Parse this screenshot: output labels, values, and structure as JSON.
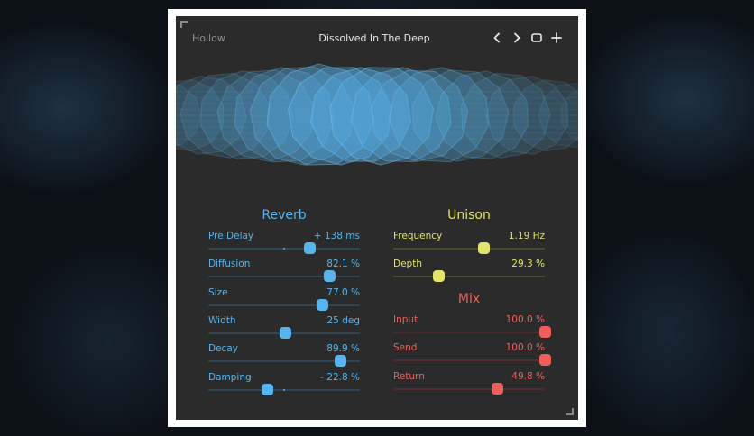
{
  "header": {
    "bank": "Hollow",
    "preset": "Dissolved In The Deep",
    "prev_icon": "chevron-left-icon",
    "next_icon": "chevron-right-icon",
    "window_icon": "window-icon",
    "add_icon": "plus-icon",
    "prev_glyph": "‹",
    "next_glyph": "›",
    "add_glyph": "+"
  },
  "colors": {
    "reverb": "#58b4ec",
    "reverb_track": "#2e4656",
    "unison": "#e3e46a",
    "unison_track": "#4a4a2c",
    "mix": "#ee5f5b",
    "mix_track": "#4e2d2d"
  },
  "reverb": {
    "title": "Reverb",
    "params": [
      {
        "name": "Pre Delay",
        "value": "+ 138 ms",
        "level": 0.67,
        "bipolar": true
      },
      {
        "name": "Diffusion",
        "value": "82.1 %",
        "level": 0.8,
        "bipolar": false
      },
      {
        "name": "Size",
        "value": "77.0 %",
        "level": 0.75,
        "bipolar": false
      },
      {
        "name": "Width",
        "value": "25 deg",
        "level": 0.51,
        "bipolar": false
      },
      {
        "name": "Decay",
        "value": "89.9 %",
        "level": 0.87,
        "bipolar": false
      },
      {
        "name": "Damping",
        "value": "- 22.8 %",
        "level": 0.39,
        "bipolar": true
      }
    ]
  },
  "unison": {
    "title": "Unison",
    "params": [
      {
        "name": "Frequency",
        "value": "1.19 Hz",
        "level": 0.6
      },
      {
        "name": "Depth",
        "value": "29.3 %",
        "level": 0.3
      }
    ]
  },
  "mix": {
    "title": "Mix",
    "params": [
      {
        "name": "Input",
        "value": "100.0 %",
        "level": 1.0
      },
      {
        "name": "Send",
        "value": "100.0 %",
        "level": 1.0
      },
      {
        "name": "Return",
        "value": "49.8 %",
        "level": 0.69
      }
    ]
  }
}
